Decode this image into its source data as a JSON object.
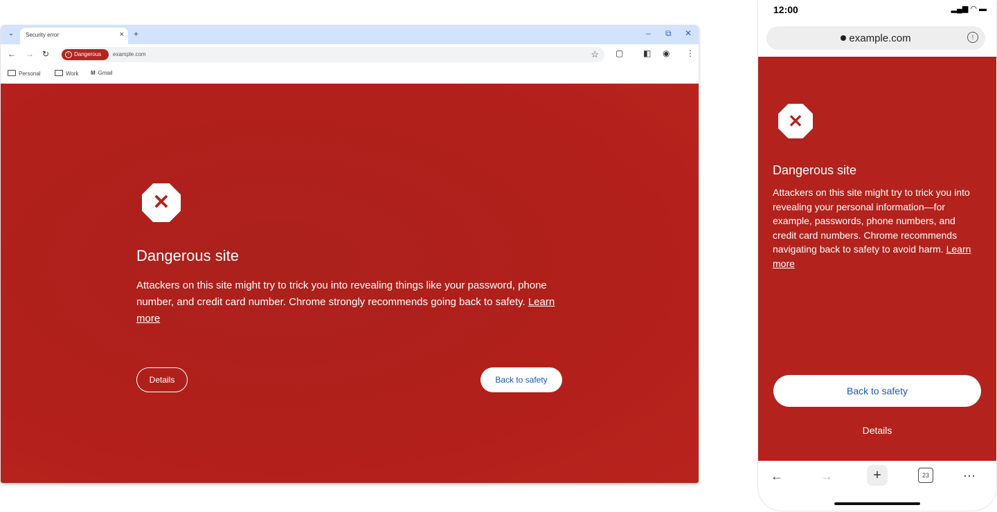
{
  "desktop": {
    "tab": {
      "title": "Security error",
      "close": "×",
      "menu": "⌄",
      "new_tab": "+"
    },
    "window_controls": {
      "minimize": "–",
      "restore": "⧉",
      "close": "✕"
    },
    "toolbar": {
      "back": "←",
      "forward": "→",
      "reload": "↻",
      "chip_label": "Dangerous",
      "url": "example.com",
      "star": "☆"
    },
    "bookmarks": [
      "Personal",
      "Work",
      "Gmail"
    ],
    "content": {
      "icon_glyph": "✕",
      "title": "Dangerous site",
      "body": "Attackers on this site might try to trick you into revealing things like your password, phone number, and credit card number. Chrome strongly recommends going back to safety.",
      "learn_more": "Learn more",
      "details_button": "Details",
      "back_button": "Back to safety"
    }
  },
  "phone": {
    "time": "12:00",
    "status_icons": "▂▄▆ ◠ ▬",
    "url": "example.com",
    "info_icon": "!",
    "content": {
      "icon_glyph": "✕",
      "title": "Dangerous site",
      "body": "Attackers on this site might try to trick you into revealing your personal information—for example, passwords, phone numbers, and credit card numbers. Chrome recommends navigating back to safety to avoid harm.",
      "learn_more": "Learn more",
      "back_button": "Back to safety",
      "details_button": "Details"
    },
    "nav": {
      "back": "←",
      "forward": "→",
      "new_tab": "+",
      "tab_count": "23",
      "more": "⋯"
    }
  },
  "colors": {
    "danger_red": "#b3221c",
    "button_text_blue": "#1a56b8"
  }
}
